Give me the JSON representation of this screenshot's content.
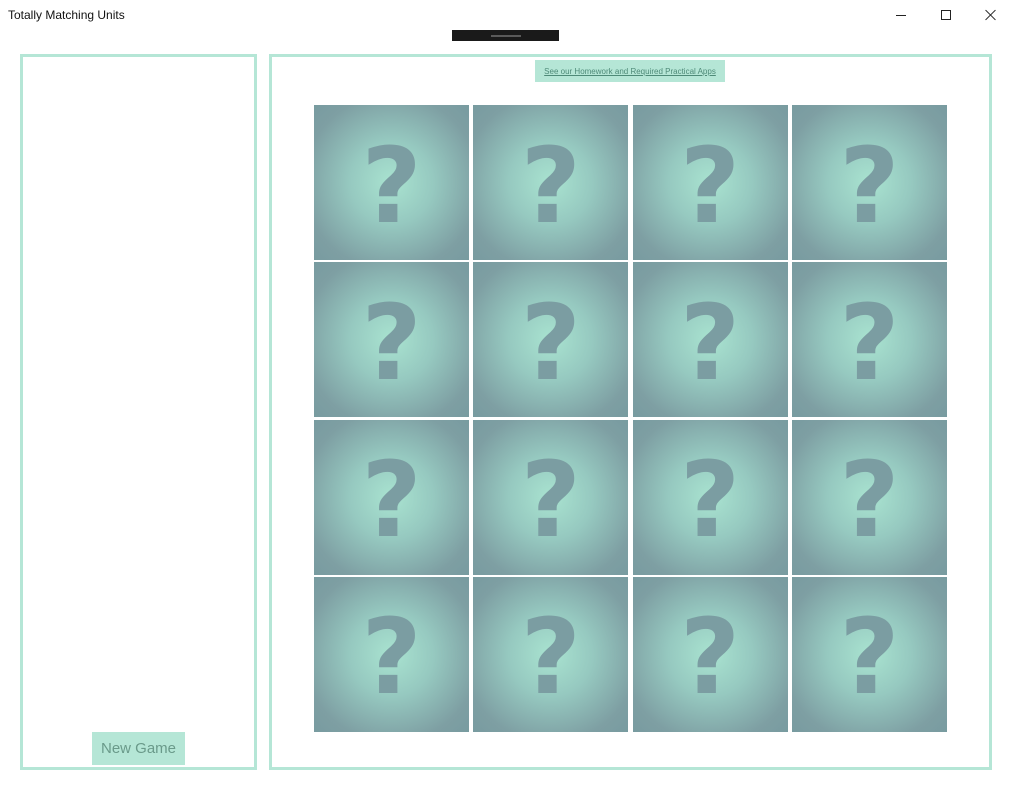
{
  "window": {
    "title": "Totally Matching Units"
  },
  "left_panel": {
    "new_game_label": "New Game"
  },
  "right_panel": {
    "promo_link": "See our Homework and Required Practical Apps"
  },
  "colors": {
    "accent": "#b5e6d6",
    "card_center": "#a9e3d0",
    "card_edge": "#789ba0",
    "question_mark": "#7b9da2"
  },
  "board": {
    "rows": 4,
    "columns": 4,
    "cards": [
      {
        "face": "?",
        "state": "hidden"
      },
      {
        "face": "?",
        "state": "hidden"
      },
      {
        "face": "?",
        "state": "hidden"
      },
      {
        "face": "?",
        "state": "hidden"
      },
      {
        "face": "?",
        "state": "hidden"
      },
      {
        "face": "?",
        "state": "hidden"
      },
      {
        "face": "?",
        "state": "hidden"
      },
      {
        "face": "?",
        "state": "hidden"
      },
      {
        "face": "?",
        "state": "hidden"
      },
      {
        "face": "?",
        "state": "hidden"
      },
      {
        "face": "?",
        "state": "hidden"
      },
      {
        "face": "?",
        "state": "hidden"
      },
      {
        "face": "?",
        "state": "hidden"
      },
      {
        "face": "?",
        "state": "hidden"
      },
      {
        "face": "?",
        "state": "hidden"
      },
      {
        "face": "?",
        "state": "hidden"
      }
    ]
  }
}
